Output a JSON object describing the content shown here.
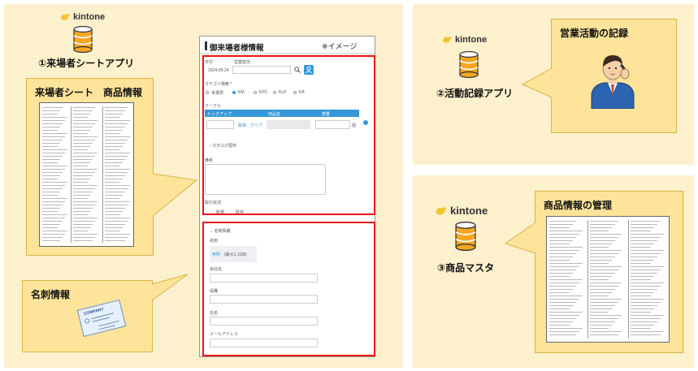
{
  "left_app": {
    "brand": "kintone",
    "label": "①来場者シートアプリ",
    "sheet_callout_title": "来場者シート　商品情報",
    "card_callout_title": "名刺情報",
    "card_company": "COMPANY"
  },
  "form": {
    "title": "御来場者様情報",
    "image_note": "※イメージ",
    "date_label": "日付",
    "staff_label": "営業担当",
    "date_value": "2024-05-24",
    "category_label": "カテゴリ検索 *",
    "category_options": [
      "未選択",
      "KM",
      "KPC",
      "KLP",
      "KB"
    ],
    "table_label": "テーブル",
    "table_headers": [
      "ルックアップ",
      "商品名",
      "数量"
    ],
    "fetch_label": "取得",
    "clear_label": "クリア",
    "table_unit": "個",
    "catalog_label": "カタログ配布",
    "remarks_label": "備考",
    "status_label": "取引状況",
    "status_options": [
      "新規",
      "既存"
    ],
    "card_section_label": "名刺情報",
    "card_field_label": "名刺",
    "card_browse": "参照",
    "card_max": "(最大1.1GB)",
    "company_label": "会社名",
    "position_label": "役職",
    "name_label": "氏名",
    "email_label": "メールアドレス"
  },
  "top_right": {
    "brand": "kintone",
    "label": "②活動記録アプリ",
    "callout_title": "営業活動の記録"
  },
  "bottom_right": {
    "brand": "kintone",
    "label": "③商品マスタ",
    "callout_title": "商品情報の管理"
  },
  "colors": {
    "panel": "#fdf0cc",
    "callout": "#fde49a",
    "callout_border": "#d9b34a",
    "highlight": "#ee1111",
    "database": "#f6a623",
    "kintone_bird": "#f4c430",
    "table_header": "#3498db"
  }
}
